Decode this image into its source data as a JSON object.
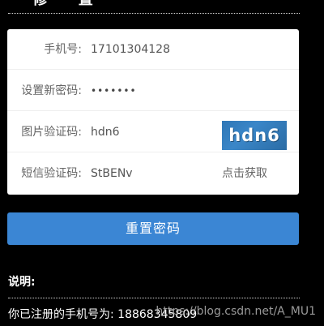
{
  "header": {
    "title": "ㄧ 修 ㄧ 置"
  },
  "form": {
    "phone": {
      "label": "手机号:",
      "value": "17101304128"
    },
    "new_password": {
      "label": "设置新密码:",
      "value": "•••••••"
    },
    "image_captcha": {
      "label": "图片验证码:",
      "value": "hdn6",
      "captcha_image_text": "hdn6"
    },
    "sms_code": {
      "label": "短信验证码:",
      "value": "StBENv",
      "action_label": "点击获取"
    }
  },
  "actions": {
    "reset_label": "重置密码"
  },
  "notes": {
    "title": "说明:",
    "text": "你已注册的手机号为: 18868345809"
  },
  "watermark": {
    "text": "https://blog.csdn.net/A_MU1"
  },
  "colors": {
    "background": "#000000",
    "card": "#ffffff",
    "button": "#3b86d4",
    "captcha": "#2f77b6"
  }
}
